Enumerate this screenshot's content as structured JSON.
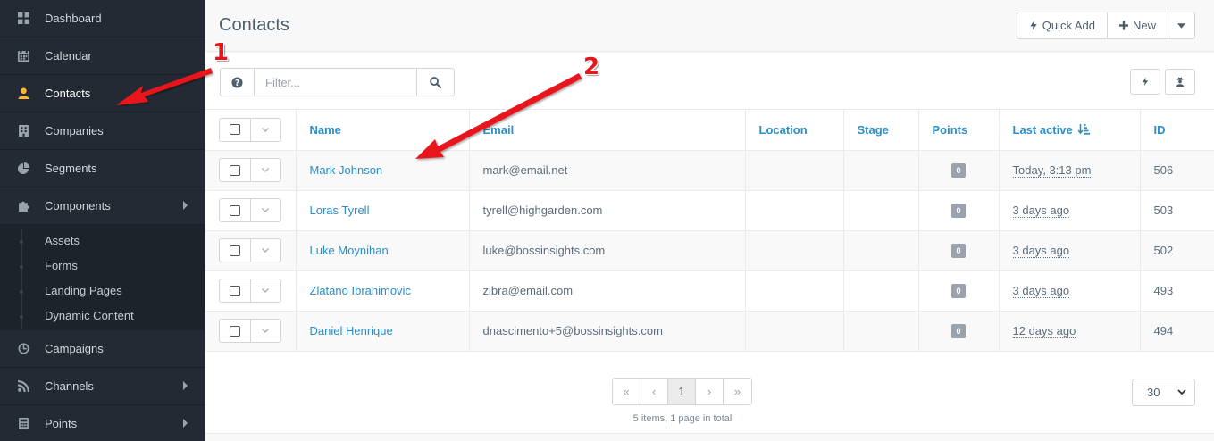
{
  "sidebar": {
    "items": [
      {
        "label": "Dashboard",
        "icon": "dashboard-icon"
      },
      {
        "label": "Calendar",
        "icon": "calendar-icon"
      },
      {
        "label": "Contacts",
        "icon": "user-icon",
        "active": true
      },
      {
        "label": "Companies",
        "icon": "building-icon"
      },
      {
        "label": "Segments",
        "icon": "pie-chart-icon"
      },
      {
        "label": "Components",
        "icon": "puzzle-icon"
      },
      {
        "label": "Campaigns",
        "icon": "clock-icon"
      },
      {
        "label": "Channels",
        "icon": "rss-icon"
      },
      {
        "label": "Points",
        "icon": "calculator-icon"
      }
    ],
    "components_sub": [
      "Assets",
      "Forms",
      "Landing Pages",
      "Dynamic Content"
    ]
  },
  "header": {
    "title": "Contacts",
    "quick_add": "Quick Add",
    "new": "New"
  },
  "toolbar": {
    "filter_placeholder": "Filter..."
  },
  "table": {
    "columns": [
      "Name",
      "Email",
      "Location",
      "Stage",
      "Points",
      "Last active",
      "ID"
    ],
    "rows": [
      {
        "name": "Mark Johnson",
        "email": "mark@email.net",
        "location": "",
        "stage": "",
        "points": "0",
        "last_active": "Today, 3:13 pm",
        "id": "506"
      },
      {
        "name": "Loras Tyrell",
        "email": "tyrell@highgarden.com",
        "location": "",
        "stage": "",
        "points": "0",
        "last_active": "3 days ago",
        "id": "503"
      },
      {
        "name": "Luke Moynihan",
        "email": "luke@bossinsights.com",
        "location": "",
        "stage": "",
        "points": "0",
        "last_active": "3 days ago",
        "id": "502"
      },
      {
        "name": "Zlatano Ibrahimovic",
        "email": "zibra@email.com",
        "location": "",
        "stage": "",
        "points": "0",
        "last_active": "3 days ago",
        "id": "493"
      },
      {
        "name": "Daniel Henrique",
        "email": "dnascimento+5@bossinsights.com",
        "location": "",
        "stage": "",
        "points": "0",
        "last_active": "12 days ago",
        "id": "494"
      }
    ]
  },
  "pagination": {
    "first": "«",
    "prev": "‹",
    "current": "1",
    "next": "›",
    "last": "»",
    "info": "5 items, 1 page in total",
    "per_page": "30"
  },
  "annotations": {
    "label_1": "1",
    "label_2": "2"
  },
  "colors": {
    "sidebar_bg": "#232a33",
    "accent_link": "#2a8ec7",
    "active_icon": "#fdb933",
    "annotation_red": "#e8151b"
  }
}
